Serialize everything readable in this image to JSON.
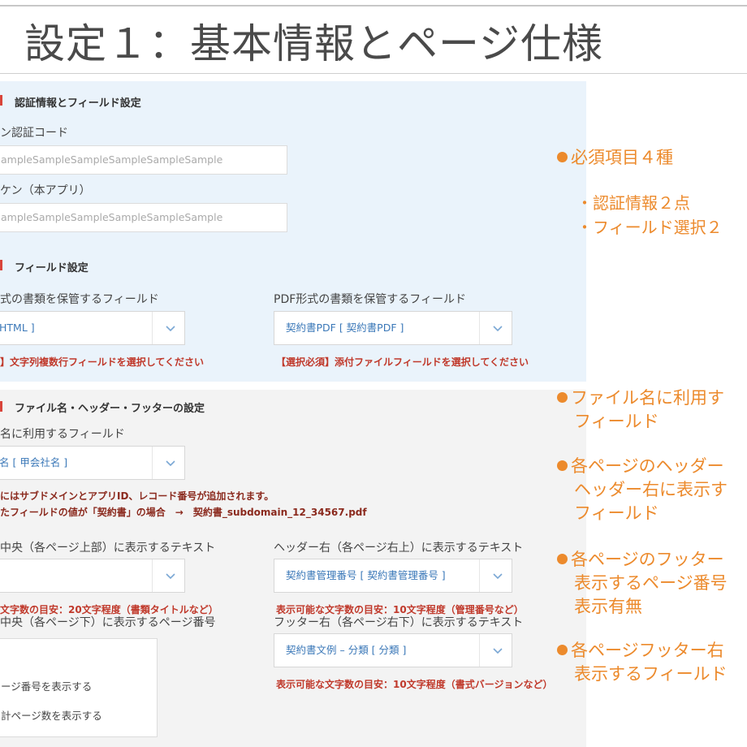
{
  "title": "設定１：基本情報とページ仕様",
  "section_auth": {
    "heading": "認証情報とフィールド設定",
    "field1_label": "ン認証コード",
    "field1_value": "ampleSampleSampleSampleSampleSample",
    "field2_label": "ケン（本アプリ）",
    "field2_value": "ampleSampleSampleSampleSampleSample"
  },
  "section_field": {
    "heading": "フィールド設定",
    "left_label": "式の書類を保管するフィールド",
    "left_value": "HTML ]",
    "left_note": "】文字列複数行フィールドを選択してください",
    "right_label": "PDF形式の書類を保管するフィールド",
    "right_value": "契約書PDF [ 契約書PDF ]",
    "right_note": "【選択必須】添付ファイルフィールドを選択してください"
  },
  "section_file": {
    "heading": "ファイル名・ヘッダー・フッターの設定",
    "name_label": "名に利用するフィールド",
    "name_value": "名 [ 甲会社名 ]",
    "name_note1": "にはサブドメインとアプリID、レコード番号が追加されます。",
    "name_note2": "たフィールドの値が「契約書」の場合　→　契約書_subdomain_12_34567.pdf",
    "header_center_label": "中央（各ページ上部）に表示するテキスト",
    "header_center_value": "",
    "header_center_note": "文字数の目安：20文字程度（書類タイトルなど）",
    "header_right_label": "ヘッダー右（各ページ右上）に表示するテキスト",
    "header_right_value": "契約書管理番号 [ 契約書管理番号 ]",
    "header_right_note": "表示可能な文字数の目安：10文字程度（管理番号など）",
    "footer_center_label": "中央（各ページ下）に表示するページ番号",
    "radio1": "ージ番号を表示する",
    "radio2": "計ページ数を表示する",
    "footer_right_label": "フッター右（各ページ右下）に表示するテキスト",
    "footer_right_value": "契約書文例 – 分類 [ 分類 ]",
    "footer_right_note": "表示可能な文字数の目安：10文字程度（書式バージョンなど）"
  },
  "annotations": {
    "a1": "必須項目４種",
    "a1_sub1": "・認証情報２点",
    "a1_sub2": "・フィールド選択２",
    "a2_line1": "ファイル名に利用す",
    "a2_line2": "フィールド",
    "a3_line1": "各ページのヘッダー",
    "a3_line2": "ヘッダー右に表示す",
    "a3_line3": "フィールド",
    "a4_line1": "各ページのフッター",
    "a4_line2": "表示するページ番号",
    "a4_line3": "表示有無",
    "a5_line1": "各ページフッター右",
    "a5_line2": "表示するフィールド"
  },
  "colors": {
    "accent": "#ec8a2c",
    "note_red": "#c0392b",
    "select_text": "#3b78b8",
    "panel_blue": "#eaf3fb",
    "panel_gray": "#f3f3f3"
  }
}
